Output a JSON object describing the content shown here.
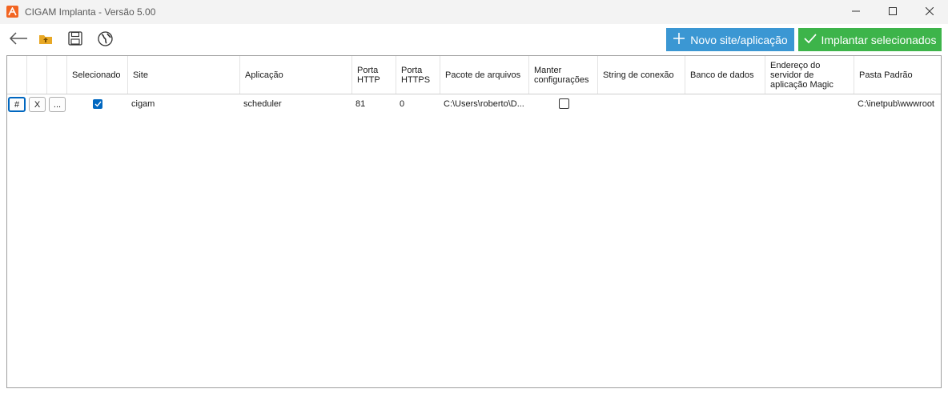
{
  "window": {
    "title": "CIGAM Implanta - Versão 5.00",
    "app_icon": "cigam-logo-icon",
    "controls": [
      "minimize-icon",
      "maximize-icon",
      "close-icon"
    ]
  },
  "toolbar": {
    "icons": [
      "back-arrow-icon",
      "open-folder-icon",
      "save-icon",
      "globe-icon"
    ],
    "new_button": "Novo site/aplicação",
    "deploy_button": "Implantar selecionados",
    "new_color": "#3b97d3",
    "deploy_color": "#3db44a"
  },
  "grid": {
    "columns": [
      "Selecionado",
      "Site",
      "Aplicação",
      "Porta HTTP",
      "Porta HTTPS",
      "Pacote de arquivos",
      "Manter configurações",
      "String de conexão",
      "Banco de dados",
      "Endereço do servidor de aplicação Magic",
      "Pasta Padrão"
    ],
    "row_buttons": [
      "#",
      "X",
      "..."
    ],
    "rows": [
      {
        "selecionado": true,
        "site": "cigam",
        "aplicacao": "scheduler",
        "porta_http": "81",
        "porta_https": "0",
        "pacote": "C:\\Users\\roberto\\D...",
        "manter": false,
        "string_conexao": "",
        "banco": "",
        "endereco_magic": "",
        "pasta": "C:\\inetpub\\wwwroot"
      }
    ]
  }
}
